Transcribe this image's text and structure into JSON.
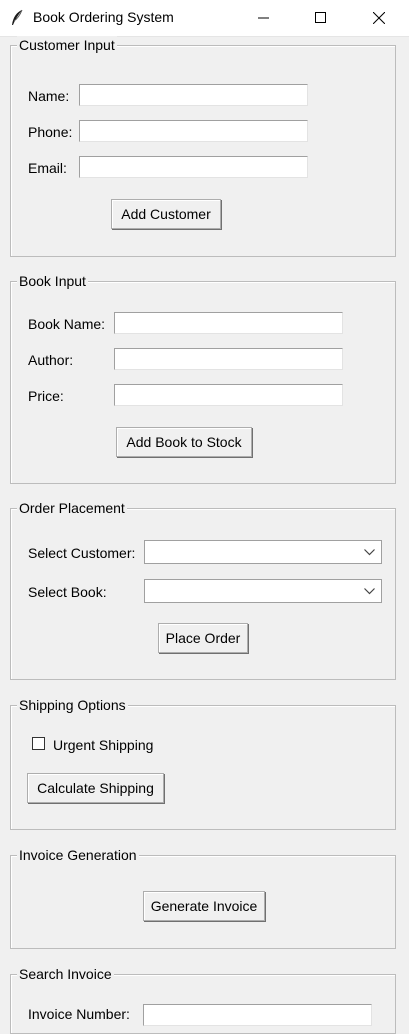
{
  "window": {
    "title": "Book Ordering System",
    "icon": "feather-icon"
  },
  "customer_input": {
    "legend": "Customer Input",
    "name_label": "Name:",
    "name_value": "",
    "phone_label": "Phone:",
    "phone_value": "",
    "email_label": "Email:",
    "email_value": "",
    "add_button": "Add Customer"
  },
  "book_input": {
    "legend": "Book Input",
    "book_name_label": "Book Name:",
    "book_name_value": "",
    "author_label": "Author:",
    "author_value": "",
    "price_label": "Price:",
    "price_value": "",
    "add_button": "Add Book to Stock"
  },
  "order_placement": {
    "legend": "Order Placement",
    "customer_label": "Select Customer:",
    "customer_value": "",
    "book_label": "Select Book:",
    "book_value": "",
    "place_button": "Place Order"
  },
  "shipping_options": {
    "legend": "Shipping Options",
    "urgent_label": "Urgent Shipping",
    "urgent_checked": false,
    "calculate_button": "Calculate Shipping"
  },
  "invoice_generation": {
    "legend": "Invoice Generation",
    "generate_button": "Generate Invoice"
  },
  "search_invoice": {
    "legend": "Search Invoice",
    "invoice_number_label": "Invoice Number:",
    "invoice_number_value": ""
  }
}
